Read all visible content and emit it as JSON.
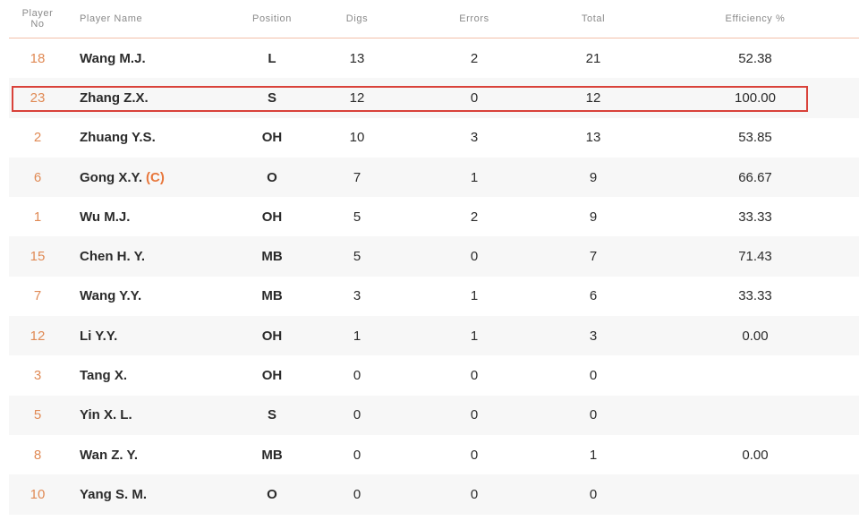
{
  "header": {
    "no_line1": "Player",
    "no_line2": "No",
    "name": "Player Name",
    "position": "Position",
    "digs": "Digs",
    "errors": "Errors",
    "total": "Total",
    "efficiency": "Efficiency %"
  },
  "rows": [
    {
      "no": "18",
      "name": "Wang M.J.",
      "captain": "",
      "pos": "L",
      "digs": "13",
      "errors": "2",
      "total": "21",
      "eff": "52.38"
    },
    {
      "no": "23",
      "name": "Zhang Z.X.",
      "captain": "",
      "pos": "S",
      "digs": "12",
      "errors": "0",
      "total": "12",
      "eff": "100.00"
    },
    {
      "no": "2",
      "name": "Zhuang Y.S.",
      "captain": "",
      "pos": "OH",
      "digs": "10",
      "errors": "3",
      "total": "13",
      "eff": "53.85"
    },
    {
      "no": "6",
      "name": "Gong X.Y.",
      "captain": "(C)",
      "pos": "O",
      "digs": "7",
      "errors": "1",
      "total": "9",
      "eff": "66.67"
    },
    {
      "no": "1",
      "name": "Wu M.J.",
      "captain": "",
      "pos": "OH",
      "digs": "5",
      "errors": "2",
      "total": "9",
      "eff": "33.33"
    },
    {
      "no": "15",
      "name": "Chen H. Y.",
      "captain": "",
      "pos": "MB",
      "digs": "5",
      "errors": "0",
      "total": "7",
      "eff": "71.43"
    },
    {
      "no": "7",
      "name": "Wang Y.Y.",
      "captain": "",
      "pos": "MB",
      "digs": "3",
      "errors": "1",
      "total": "6",
      "eff": "33.33"
    },
    {
      "no": "12",
      "name": "Li Y.Y.",
      "captain": "",
      "pos": "OH",
      "digs": "1",
      "errors": "1",
      "total": "3",
      "eff": "0.00"
    },
    {
      "no": "3",
      "name": "Tang X.",
      "captain": "",
      "pos": "OH",
      "digs": "0",
      "errors": "0",
      "total": "0",
      "eff": ""
    },
    {
      "no": "5",
      "name": "Yin X. L.",
      "captain": "",
      "pos": "S",
      "digs": "0",
      "errors": "0",
      "total": "0",
      "eff": ""
    },
    {
      "no": "8",
      "name": "Wan Z. Y.",
      "captain": "",
      "pos": "MB",
      "digs": "0",
      "errors": "0",
      "total": "1",
      "eff": "0.00"
    },
    {
      "no": "10",
      "name": "Yang S. M.",
      "captain": "",
      "pos": "O",
      "digs": "0",
      "errors": "0",
      "total": "0",
      "eff": ""
    }
  ],
  "colors": {
    "accent_orange": "#e08a55",
    "highlight_red": "#d9423a",
    "header_rule": "#f2c0a8",
    "row_shade": "#f7f7f7"
  }
}
